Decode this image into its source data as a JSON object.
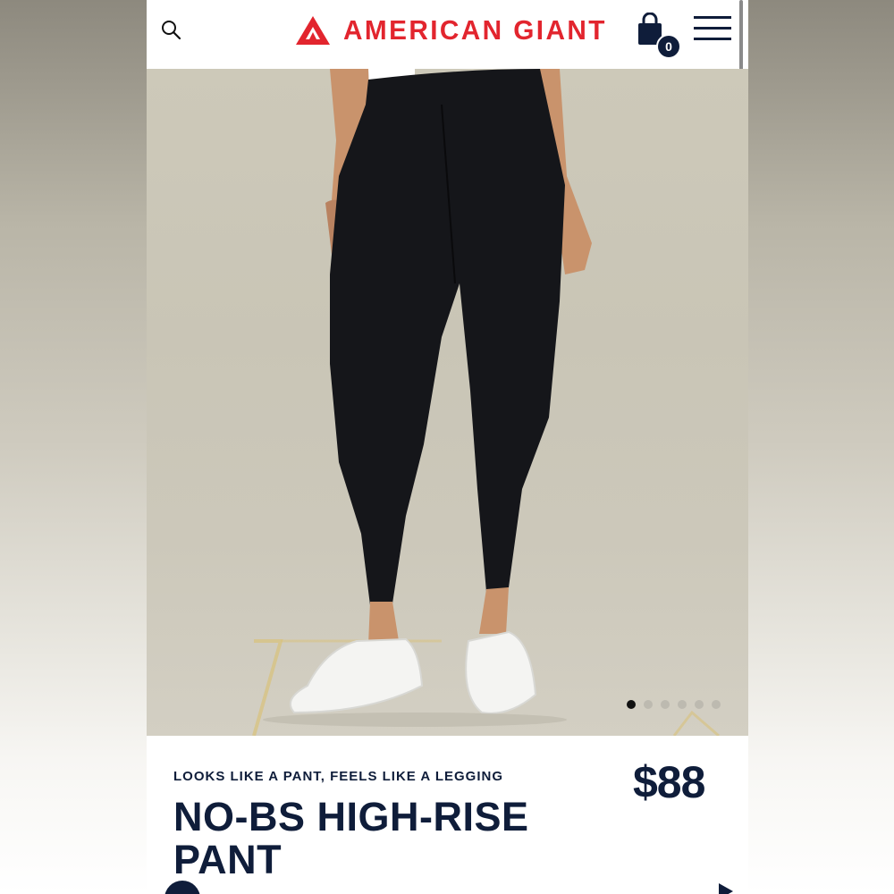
{
  "header": {
    "brand": "AMERICAN GIANT",
    "cart_count": "0",
    "icons": {
      "search": "search-icon",
      "cart": "shopping-bag-icon",
      "menu": "hamburger-menu-icon",
      "logo": "triangle-logo-icon"
    }
  },
  "colors": {
    "brand_red": "#e2252e",
    "navy": "#0f1d3a",
    "background": "#ffffff"
  },
  "gallery": {
    "image_subject": "model wearing black high-rise leggings and white sneakers",
    "slide_count": 6,
    "active_slide": 1
  },
  "product": {
    "tagline": "LOOKS LIKE A PANT, FEELS LIKE A LEGGING",
    "title": "NO-BS HIGH-RISE PANT",
    "price": "$88"
  }
}
